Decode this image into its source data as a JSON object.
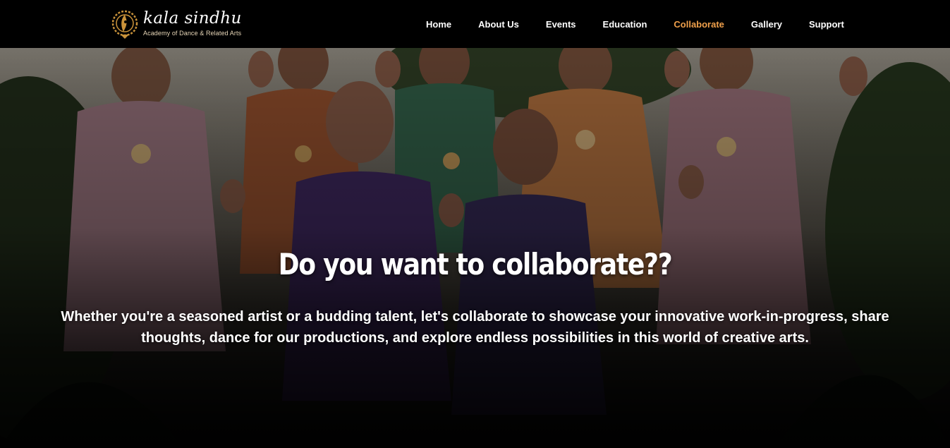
{
  "header": {
    "logo": {
      "name": "kala sindhu",
      "tagline": "Academy of Dance & Related Arts"
    },
    "nav": [
      {
        "label": "Home",
        "active": false
      },
      {
        "label": "About Us",
        "active": false
      },
      {
        "label": "Events",
        "active": false
      },
      {
        "label": "Education",
        "active": false
      },
      {
        "label": "Collaborate",
        "active": true
      },
      {
        "label": "Gallery",
        "active": false
      },
      {
        "label": "Support",
        "active": false
      }
    ]
  },
  "hero": {
    "title": "Do you want to collaborate??",
    "text": "Whether you're a seasoned artist or a budding talent, let's collaborate to showcase your innovative work-in-progress, share thoughts, dance for our productions, and explore endless possibilities in this world of creative arts."
  },
  "colors": {
    "header_bg": "#000000",
    "nav_text": "#ffffff",
    "nav_active": "#f0a04b",
    "logo_gold": "#c9923a"
  }
}
